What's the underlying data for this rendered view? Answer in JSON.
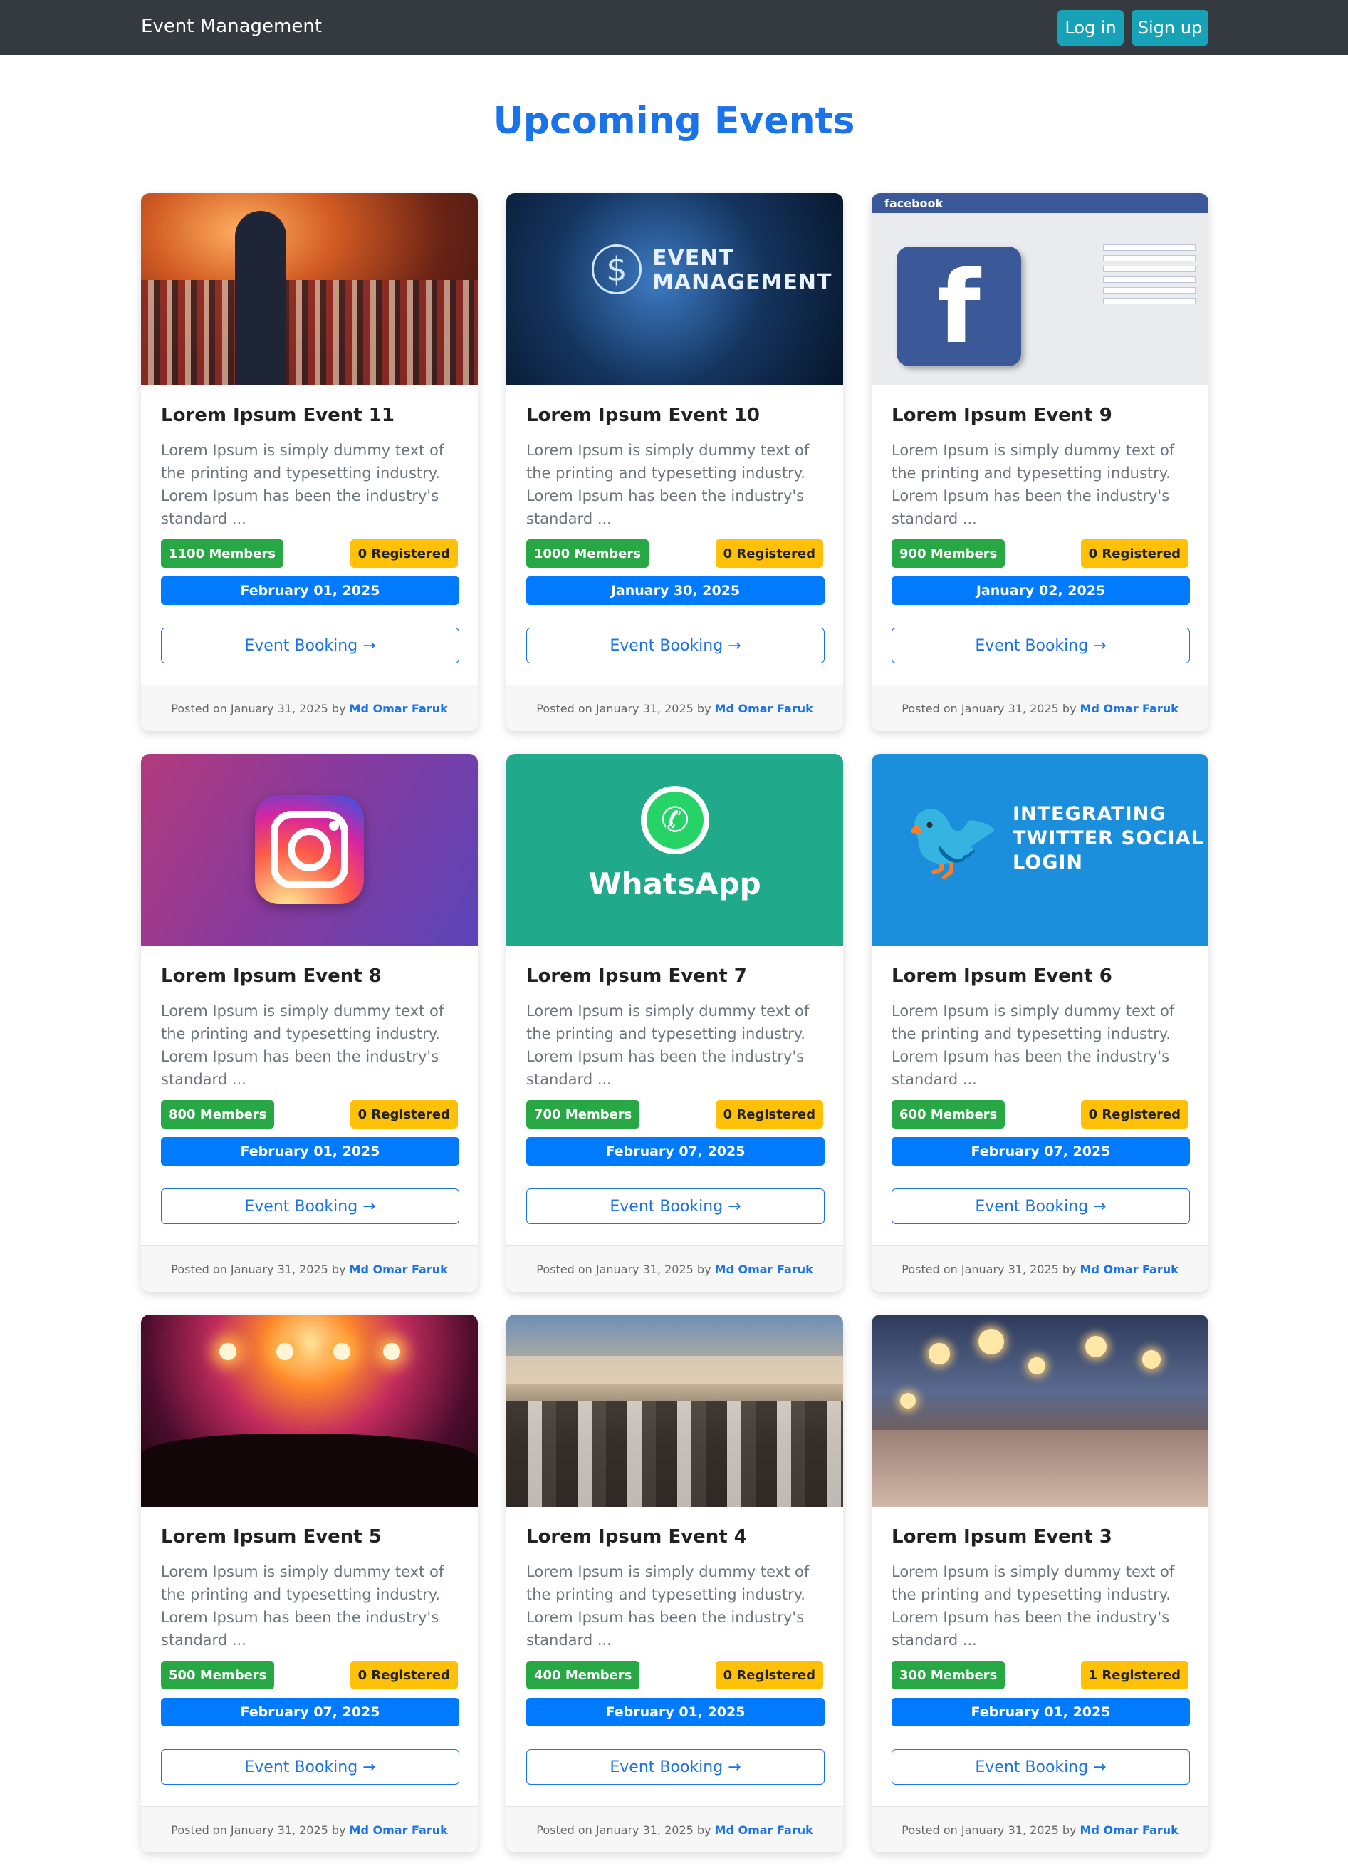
{
  "navbar": {
    "brand": "Event Management",
    "login_label": "Log in",
    "signup_label": "Sign up"
  },
  "page_title": "Upcoming Events",
  "events": [
    {
      "title": "Lorem Ipsum Event 11",
      "description": "Lorem Ipsum is simply dummy text of the printing and typesetting industry. Lorem Ipsum has been the industry's standard ...",
      "members": "1100 Members",
      "registered": "0 Registered",
      "date": "February 01, 2025",
      "button": "Event Booking →",
      "posted": "Posted on January 31, 2025 by",
      "author": "Md Omar Faruk",
      "image": "speaker-photo"
    },
    {
      "title": "Lorem Ipsum Event 10",
      "description": "Lorem Ipsum is simply dummy text of the printing and typesetting industry. Lorem Ipsum has been the industry's standard ...",
      "members": "1000 Members",
      "registered": "0 Registered",
      "date": "January 30, 2025",
      "button": "Event Booking →",
      "posted": "Posted on January 31, 2025 by",
      "author": "Md Omar Faruk",
      "image": "event-management-graphic",
      "image_text": [
        "EVENT",
        "MANAGEMENT"
      ]
    },
    {
      "title": "Lorem Ipsum Event 9",
      "description": "Lorem Ipsum is simply dummy text of the printing and typesetting industry. Lorem Ipsum has been the industry's standard ...",
      "members": "900 Members",
      "registered": "0 Registered",
      "date": "January 02, 2025",
      "button": "Event Booking →",
      "posted": "Posted on January 31, 2025 by",
      "author": "Md Omar Faruk",
      "image": "facebook-screenshot",
      "image_text": "facebook"
    },
    {
      "title": "Lorem Ipsum Event 8",
      "description": "Lorem Ipsum is simply dummy text of the printing and typesetting industry. Lorem Ipsum has been the industry's standard ...",
      "members": "800 Members",
      "registered": "0 Registered",
      "date": "February 01, 2025",
      "button": "Event Booking →",
      "posted": "Posted on January 31, 2025 by",
      "author": "Md Omar Faruk",
      "image": "instagram-logo"
    },
    {
      "title": "Lorem Ipsum Event 7",
      "description": "Lorem Ipsum is simply dummy text of the printing and typesetting industry. Lorem Ipsum has been the industry's standard ...",
      "members": "700 Members",
      "registered": "0 Registered",
      "date": "February 07, 2025",
      "button": "Event Booking →",
      "posted": "Posted on January 31, 2025 by",
      "author": "Md Omar Faruk",
      "image": "whatsapp-logo",
      "image_text": "WhatsApp"
    },
    {
      "title": "Lorem Ipsum Event 6",
      "description": "Lorem Ipsum is simply dummy text of the printing and typesetting industry. Lorem Ipsum has been the industry's standard ...",
      "members": "600 Members",
      "registered": "0 Registered",
      "date": "February 07, 2025",
      "button": "Event Booking →",
      "posted": "Posted on January 31, 2025 by",
      "author": "Md Omar Faruk",
      "image": "twitter-banner",
      "image_text": [
        "INTEGRATING",
        "TWITTER SOCIAL",
        "LOGIN"
      ]
    },
    {
      "title": "Lorem Ipsum Event 5",
      "description": "Lorem Ipsum is simply dummy text of the printing and typesetting industry. Lorem Ipsum has been the industry's standard ...",
      "members": "500 Members",
      "registered": "0 Registered",
      "date": "February 07, 2025",
      "button": "Event Booking →",
      "posted": "Posted on January 31, 2025 by",
      "author": "Md Omar Faruk",
      "image": "concert-photo"
    },
    {
      "title": "Lorem Ipsum Event 4",
      "description": "Lorem Ipsum is simply dummy text of the printing and typesetting industry. Lorem Ipsum has been the industry's standard ...",
      "members": "400 Members",
      "registered": "0 Registered",
      "date": "February 01, 2025",
      "button": "Event Booking →",
      "posted": "Posted on January 31, 2025 by",
      "author": "Md Omar Faruk",
      "image": "conference-photo"
    },
    {
      "title": "Lorem Ipsum Event 3",
      "description": "Lorem Ipsum is simply dummy text of the printing and typesetting industry. Lorem Ipsum has been the industry's standard ...",
      "members": "300 Members",
      "registered": "1 Registered",
      "date": "February 01, 2025",
      "button": "Event Booking →",
      "posted": "Posted on January 31, 2025 by",
      "author": "Md Omar Faruk",
      "image": "party-photo"
    }
  ],
  "colors": {
    "navbar": "#343a40",
    "nav_button": "#17a2b8",
    "title": "#1a73e8",
    "members_badge": "#28a745",
    "registered_badge": "#ffc107",
    "date_bar": "#007bff"
  }
}
